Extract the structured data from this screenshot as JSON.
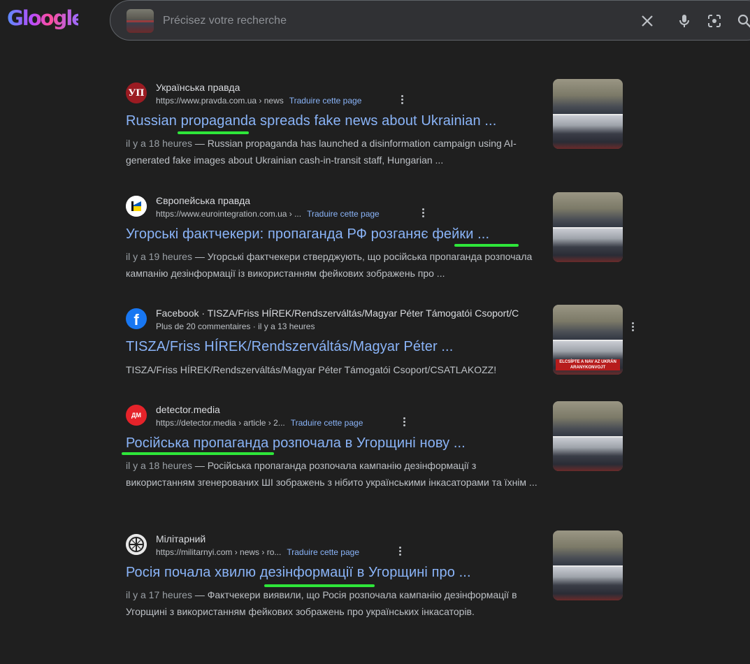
{
  "header": {
    "logo_text": "Gloogle",
    "search": {
      "placeholder": "Précisez votre recherche",
      "value": ""
    },
    "icons": [
      "clear-icon",
      "microphone-icon",
      "lens-icon",
      "search-icon"
    ]
  },
  "results": [
    {
      "site_name": "Українська правда",
      "url": "https://www.pravda.com.ua › news",
      "translate": "Traduire cette page",
      "title": "Russian propaganda spreads fake news about Ukrainian ...",
      "ago": "il y a 18 heures",
      "snippet": " — Russian propaganda has launched a disinformation campaign using AI-generated fake images about Ukrainian cash-in-transit staff, Hungarian ...",
      "favicon_text": "УП",
      "favicon_bg": "#9b1b22"
    },
    {
      "site_name": "Європейська правда",
      "url": "https://www.eurointegration.com.ua › ...",
      "translate": "Traduire cette page",
      "title": "Угорські фактчекери: пропаганда РФ розганяє фейки ...",
      "ago": "il y a 19 heures",
      "snippet": " — Угорські фактчекери стверджують, що російська пропаганда розпочала кампанію дезінформації із використанням фейкових зображень про ...",
      "favicon_text": "",
      "favicon_bg": "#ffffff"
    },
    {
      "site_name": "Facebook · TISZA/Friss HÍREK/Rendszerváltás/Magyar Péter Támogatói Csoport/C",
      "url": "Plus de 20 commentaires · il y a 13 heures",
      "translate": "",
      "title": "TISZA/Friss HÍREK/Rendszerváltás/Magyar Péter ...",
      "ago": "",
      "snippet": "TISZA/Friss HÍREK/Rendszerváltás/Magyar Péter Támogatói Csoport/CSATLAKOZZ!",
      "favicon_text": "f",
      "favicon_bg": "#1877f2",
      "thumb_banner": "ELCSÍPTE A NAV AZ UKRÁN ARANYKONVOJT"
    },
    {
      "site_name": "detector.media",
      "url": "https://detector.media › article › 2...",
      "translate": "Traduire cette page",
      "title": "Російська пропаганда розпочала в Угорщині нову ...",
      "ago": "il y a 18 heures",
      "snippet": " — Російська пропаганда розпочала кампанію дезінформації з використанням згенерованих ШІ зображень з нібито українськими інкасаторами та їхнім ...",
      "favicon_text": "ДМ",
      "favicon_bg": "#e5232a"
    },
    {
      "site_name": "Мілітарний",
      "url": "https://militarnyi.com › news › ro...",
      "translate": "Traduire cette page",
      "title": "Росія почала хвилю дезінформації в Угорщині про ...",
      "ago": "il y a 17 heures",
      "snippet": " — Фактчекери виявили, що Росія розпочала кампанію дезінформації в Угорщині з використанням фейкових зображень про українських інкасаторів.",
      "favicon_text": "",
      "favicon_bg": "#e8e8e8"
    }
  ],
  "colors": {
    "link": "#8ab4f8",
    "highlight": "#2ee63a",
    "background": "#1f1f1f"
  }
}
